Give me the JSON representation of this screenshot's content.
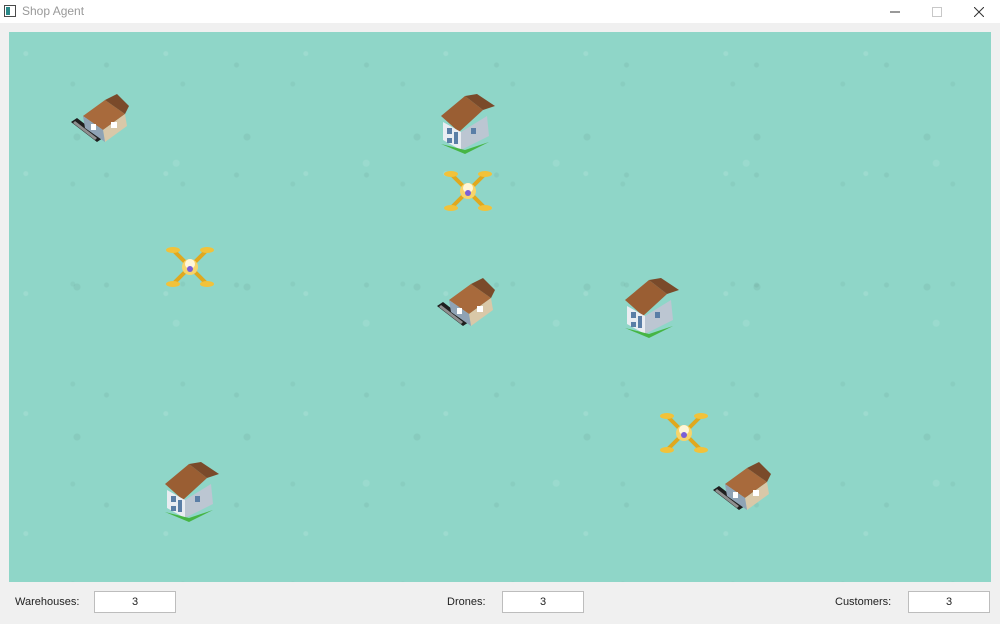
{
  "window": {
    "title": "Shop Agent",
    "icon": "app-window-icon",
    "controls": [
      "minimize-icon",
      "maximize-icon",
      "close-icon"
    ]
  },
  "map": {
    "background_color": "#8fd6c8",
    "entities": [
      {
        "kind": "warehouse",
        "icon": "warehouse-icon"
      },
      {
        "kind": "warehouse",
        "icon": "warehouse-icon"
      },
      {
        "kind": "warehouse",
        "icon": "warehouse-icon"
      },
      {
        "kind": "customer",
        "icon": "customer-house-icon"
      },
      {
        "kind": "customer",
        "icon": "customer-house-icon"
      },
      {
        "kind": "customer",
        "icon": "customer-house-icon"
      },
      {
        "kind": "drone",
        "icon": "drone-icon"
      },
      {
        "kind": "drone",
        "icon": "drone-icon"
      },
      {
        "kind": "drone",
        "icon": "drone-icon"
      }
    ]
  },
  "stats": {
    "warehouses_label": "Warehouses:",
    "warehouses_value": "3",
    "drones_label": "Drones:",
    "drones_value": "3",
    "customers_label": "Customers:",
    "customers_value": "3"
  }
}
